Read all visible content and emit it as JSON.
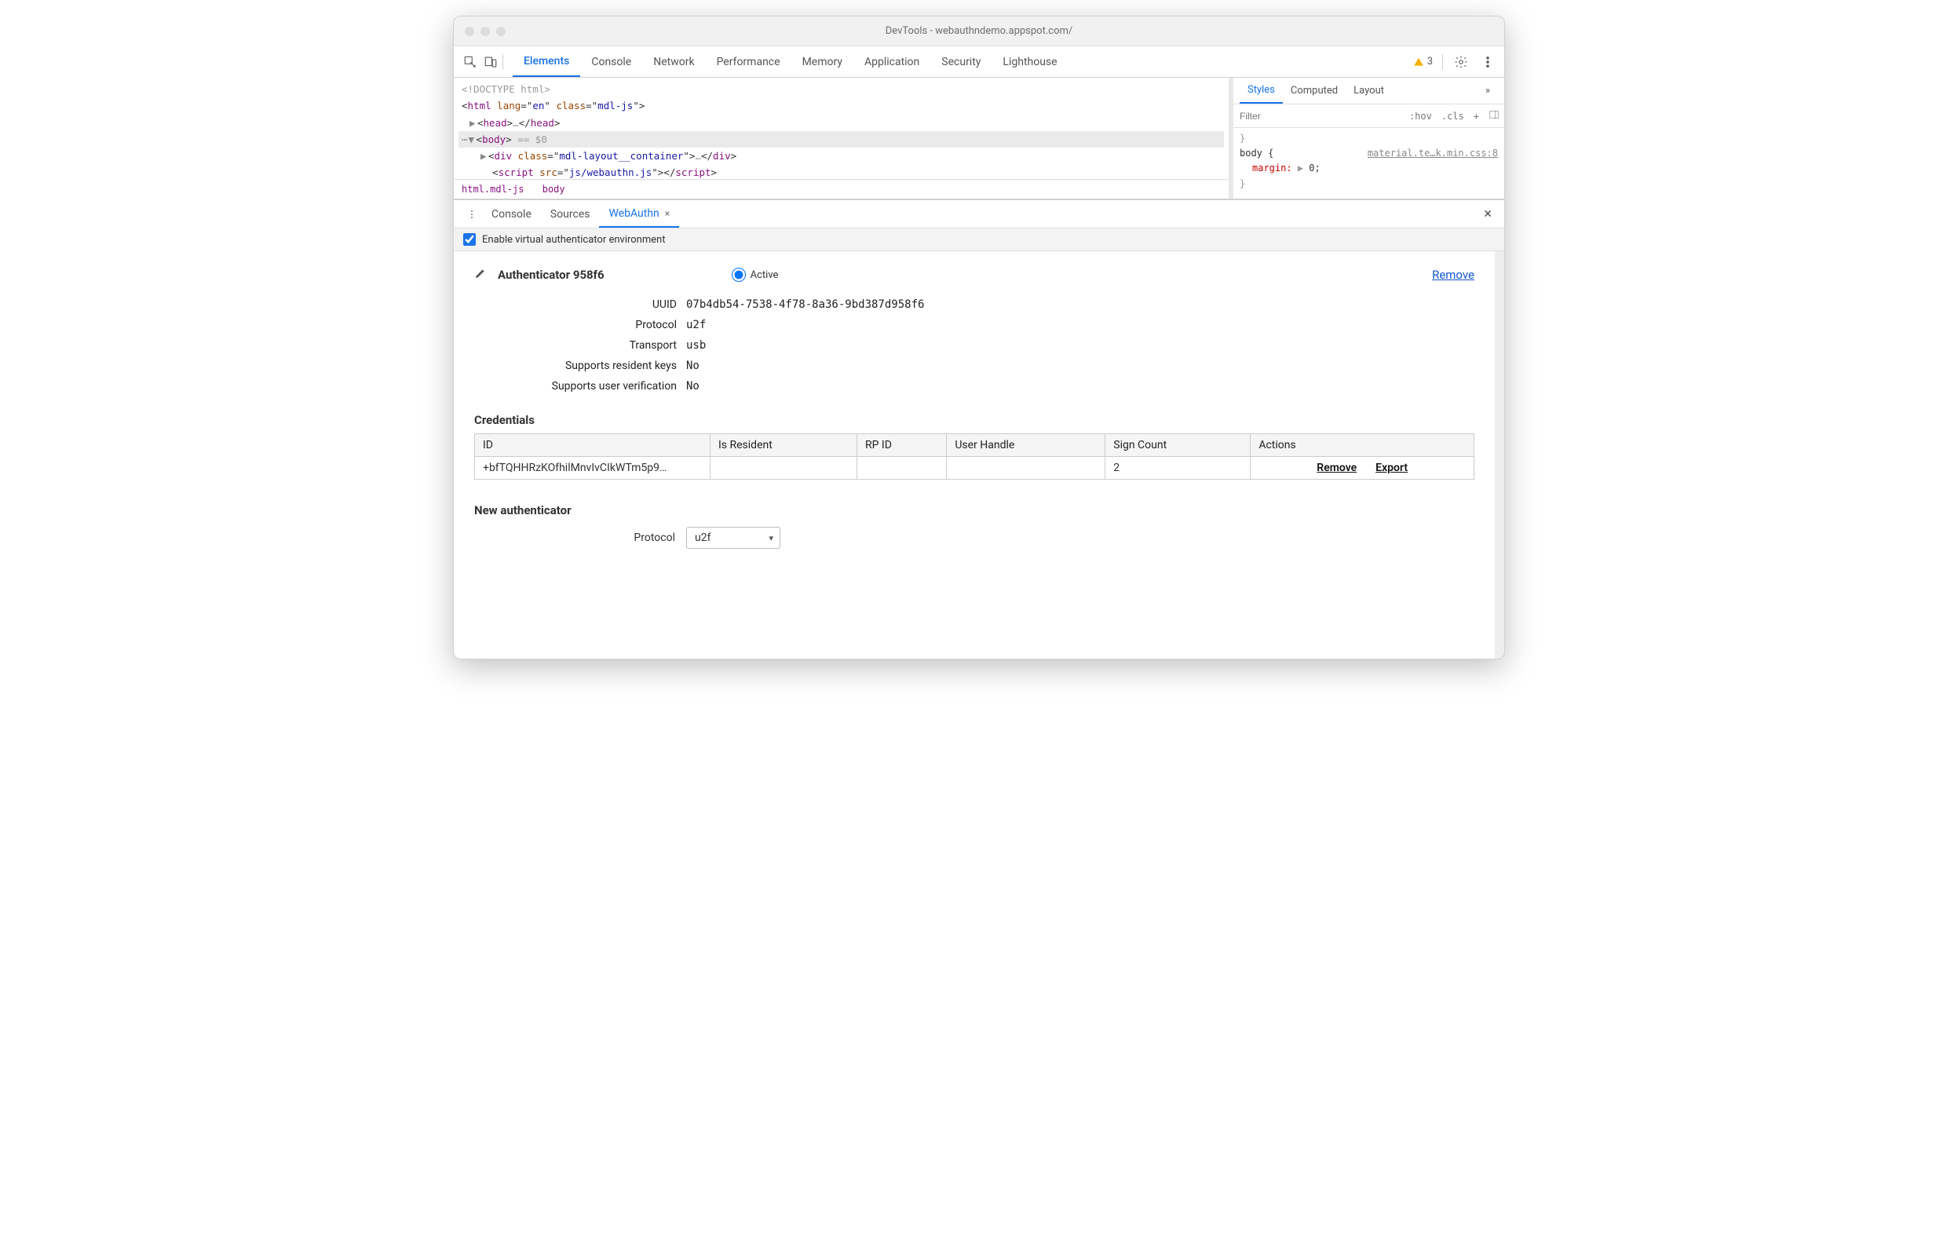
{
  "titlebar": {
    "title": "DevTools - webauthndemo.appspot.com/"
  },
  "topTabs": [
    "Elements",
    "Console",
    "Network",
    "Performance",
    "Memory",
    "Application",
    "Security",
    "Lighthouse"
  ],
  "warningCount": "3",
  "dom": {
    "doctype": "<!DOCTYPE html>",
    "htmlOpen1": "html",
    "htmlLang": "en",
    "htmlClass": "mdl-js",
    "head": "head",
    "headDots": "…",
    "body": "body",
    "bodySel": " == $0",
    "divTag": "div",
    "divClassAttr": "class",
    "divClass": "mdl-layout__container",
    "divDots": "…",
    "scriptTag": "script",
    "scriptAttr": "src",
    "scriptSrc": "js/webauthn.js"
  },
  "breadcrumb": {
    "a": "html.mdl-js",
    "b": "body"
  },
  "stylesTabs": [
    "Styles",
    "Computed",
    "Layout"
  ],
  "stylesFilter": {
    "placeholder": "Filter",
    "hov": ":hov",
    "cls": ".cls",
    "plus": "+"
  },
  "css": {
    "openBrace": "}",
    "selector": "body {",
    "link": "material.te…k.min.css:8",
    "propMargin": "margin",
    "propVal": "0;",
    "closeBrace": "}"
  },
  "drawerTabs": {
    "console": "Console",
    "sources": "Sources",
    "webauthn": "WebAuthn"
  },
  "enableLabel": "Enable virtual authenticator environment",
  "auth": {
    "title": "Authenticator 958f6",
    "active": "Active",
    "remove": "Remove",
    "labels": {
      "uuid": "UUID",
      "protocol": "Protocol",
      "transport": "Transport",
      "srk": "Supports resident keys",
      "suv": "Supports user verification"
    },
    "values": {
      "uuid": "07b4db54-7538-4f78-8a36-9bd387d958f6",
      "protocol": "u2f",
      "transport": "usb",
      "srk": "No",
      "suv": "No"
    }
  },
  "credentials": {
    "title": "Credentials",
    "headers": [
      "ID",
      "Is Resident",
      "RP ID",
      "User Handle",
      "Sign Count",
      "Actions"
    ],
    "row": {
      "id": "+bfTQHHRzKOfhilMnvIvCIkWTm5p9…",
      "isResident": "",
      "rpId": "",
      "userHandle": "",
      "signCount": "2",
      "actionRemove": "Remove",
      "actionExport": "Export"
    }
  },
  "newAuth": {
    "title": "New authenticator",
    "protocolLabel": "Protocol",
    "protocolValue": "u2f"
  }
}
